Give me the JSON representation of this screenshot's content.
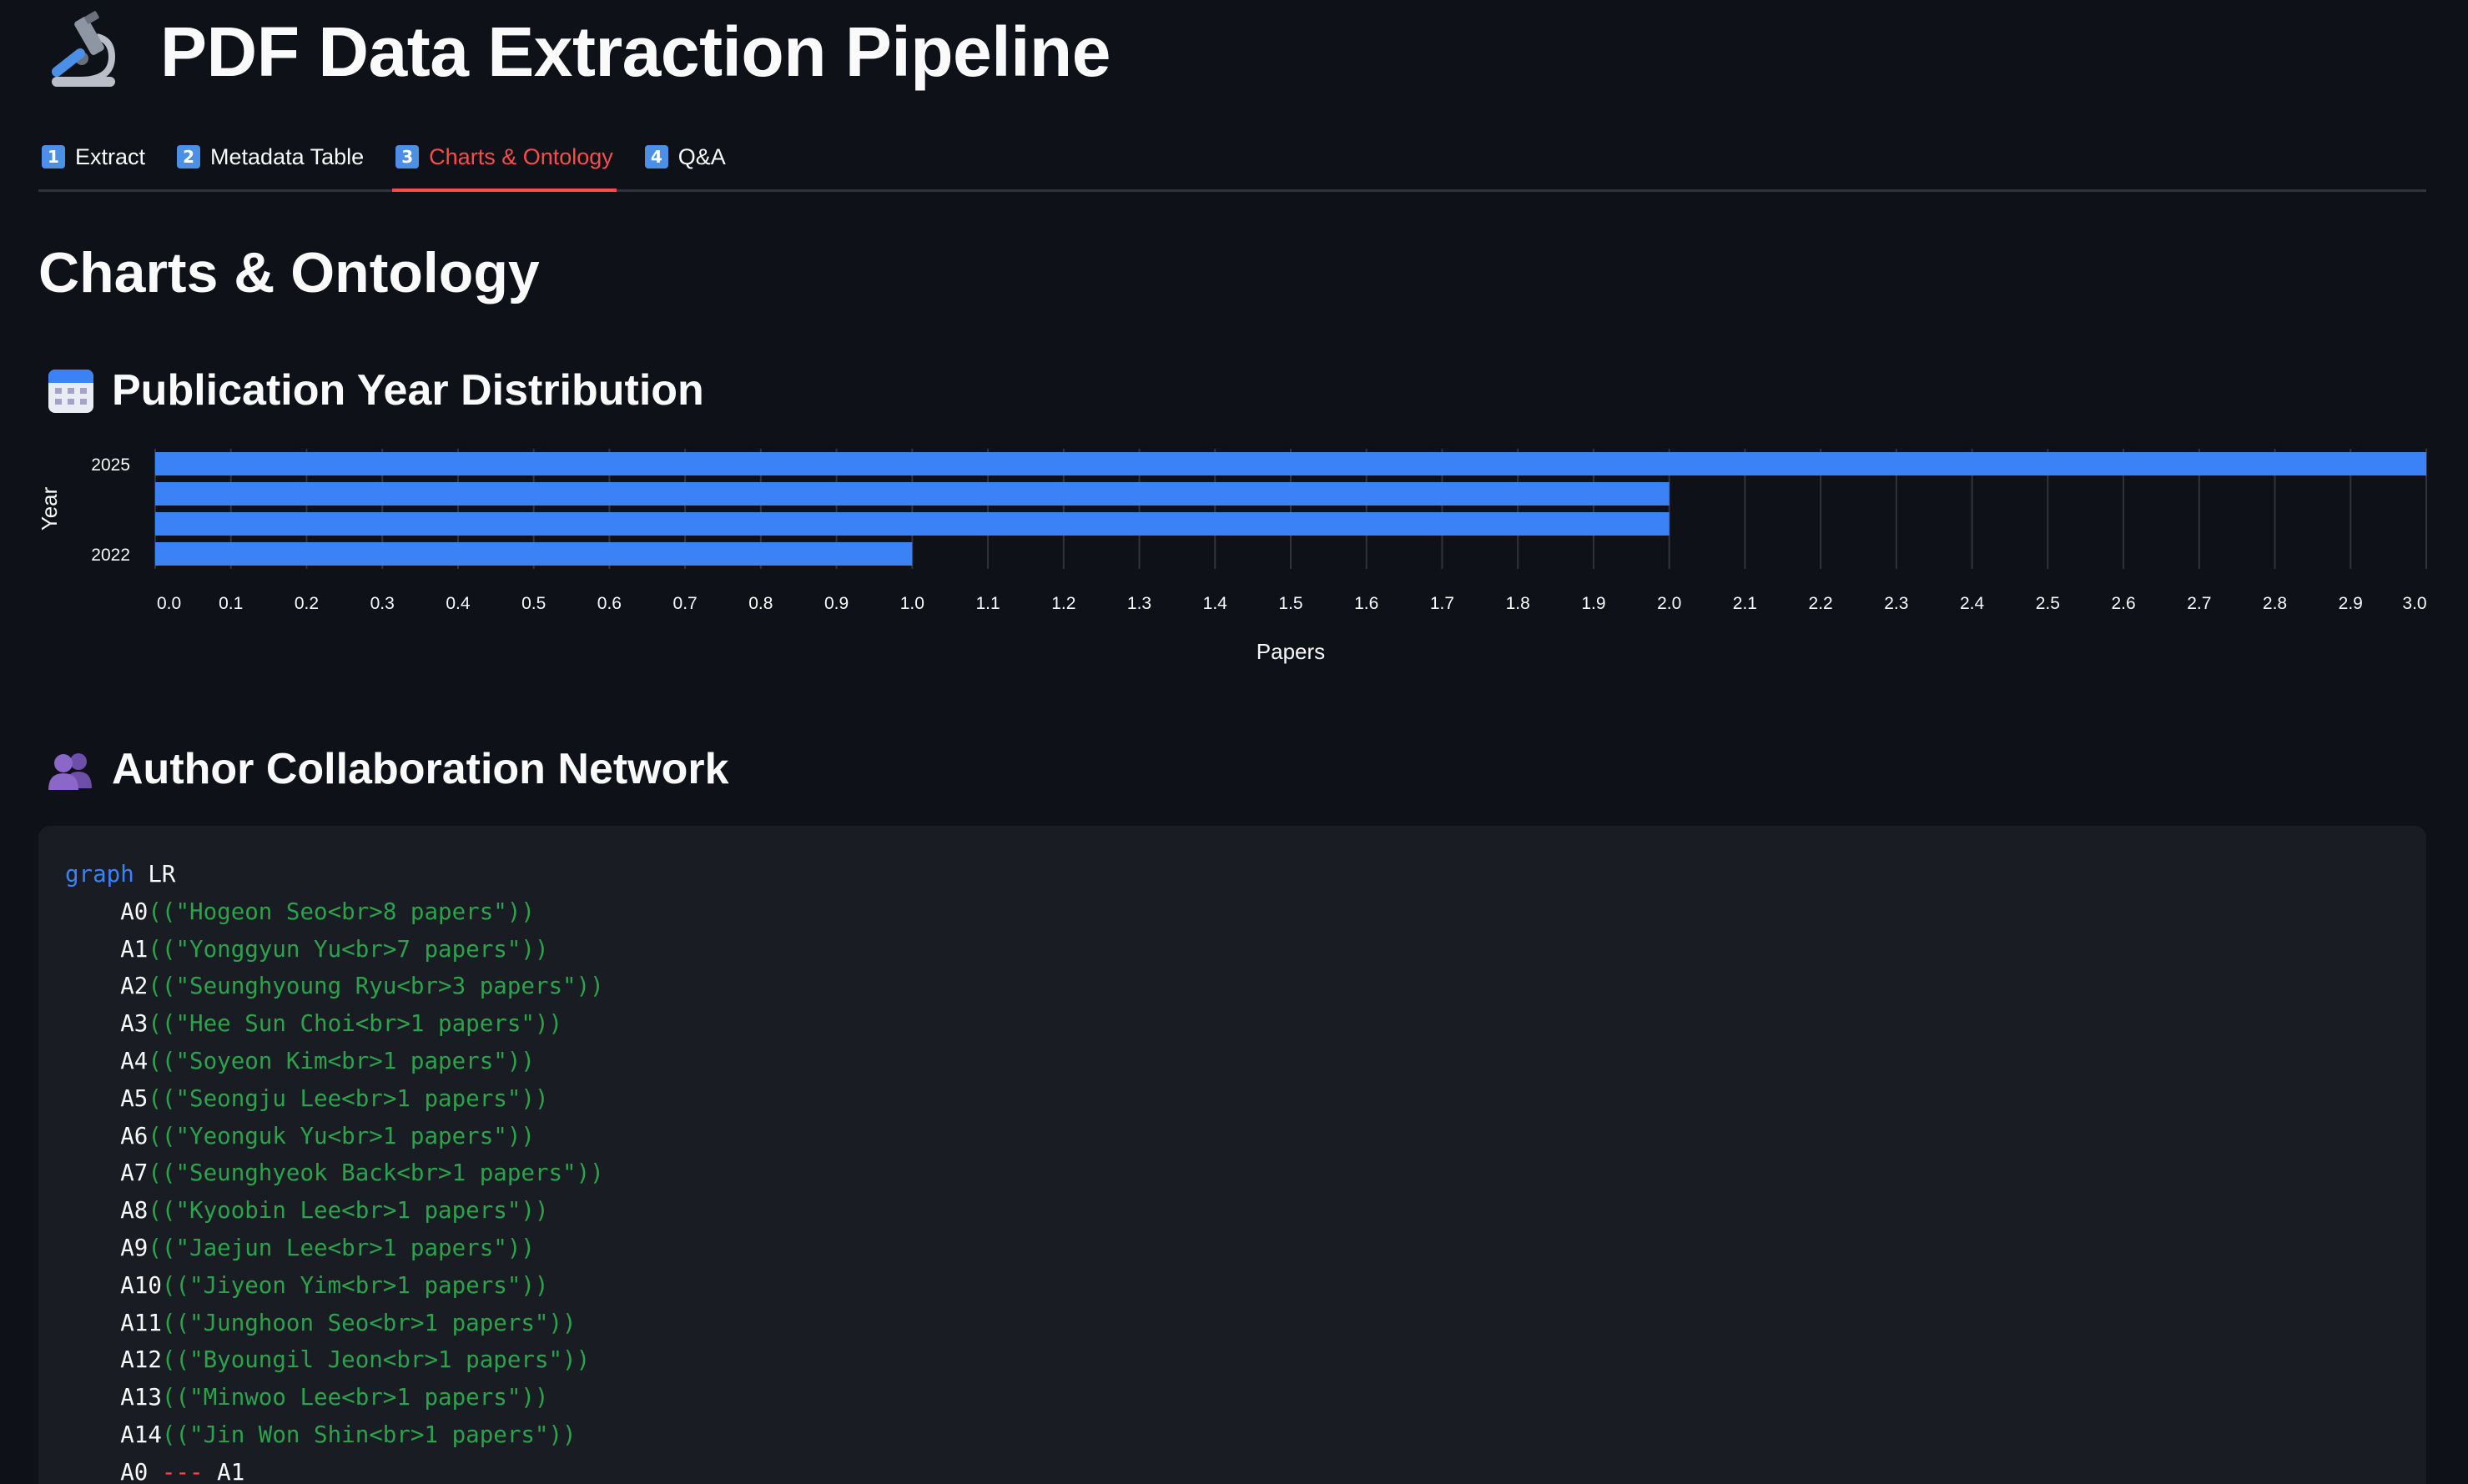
{
  "app": {
    "title": "PDF Data Extraction Pipeline",
    "icon": "microscope-icon"
  },
  "tabs": [
    {
      "num": "1",
      "label": "Extract",
      "active": false
    },
    {
      "num": "2",
      "label": "Metadata Table",
      "active": false
    },
    {
      "num": "3",
      "label": "Charts & Ontology",
      "active": true
    },
    {
      "num": "4",
      "label": "Q&A",
      "active": false
    }
  ],
  "main": {
    "section_title": "Charts & Ontology",
    "year_header": "Publication Year Distribution",
    "year_icon": "calendar-icon",
    "network_header": "Author Collaboration Network",
    "network_icon": "people-icon"
  },
  "colors": {
    "background": "#0e1117",
    "bar": "#3b82f6",
    "accent": "#ff4b4b",
    "code_bg": "#1a1c24",
    "code_string": "#2aa34a",
    "code_keyword": "#3b82f6"
  },
  "chart_data": {
    "type": "bar",
    "orientation": "horizontal",
    "categories": [
      "2025",
      "",
      "",
      "2022"
    ],
    "values": [
      3,
      2,
      2,
      1
    ],
    "xlabel": "Papers",
    "ylabel": "Year",
    "xlim": [
      0,
      3
    ],
    "xticks": [
      "0.0",
      "0.1",
      "0.2",
      "0.3",
      "0.4",
      "0.5",
      "0.6",
      "0.7",
      "0.8",
      "0.9",
      "1.0",
      "1.1",
      "1.2",
      "1.3",
      "1.4",
      "1.5",
      "1.6",
      "1.7",
      "1.8",
      "1.9",
      "2.0",
      "2.1",
      "2.2",
      "2.3",
      "2.4",
      "2.5",
      "2.6",
      "2.7",
      "2.8",
      "2.9",
      "3.0"
    ],
    "grid": true
  },
  "code": {
    "keyword": "graph",
    "direction": "LR",
    "nodes": [
      {
        "id": "A0",
        "label": "((\"Hogeon Seo<br>8 papers\"))"
      },
      {
        "id": "A1",
        "label": "((\"Yonggyun Yu<br>7 papers\"))"
      },
      {
        "id": "A2",
        "label": "((\"Seunghyoung Ryu<br>3 papers\"))"
      },
      {
        "id": "A3",
        "label": "((\"Hee Sun Choi<br>1 papers\"))"
      },
      {
        "id": "A4",
        "label": "((\"Soyeon Kim<br>1 papers\"))"
      },
      {
        "id": "A5",
        "label": "((\"Seongju Lee<br>1 papers\"))"
      },
      {
        "id": "A6",
        "label": "((\"Yeonguk Yu<br>1 papers\"))"
      },
      {
        "id": "A7",
        "label": "((\"Seunghyeok Back<br>1 papers\"))"
      },
      {
        "id": "A8",
        "label": "((\"Kyoobin Lee<br>1 papers\"))"
      },
      {
        "id": "A9",
        "label": "((\"Jaejun Lee<br>1 papers\"))"
      },
      {
        "id": "A10",
        "label": "((\"Jiyeon Yim<br>1 papers\"))"
      },
      {
        "id": "A11",
        "label": "((\"Junghoon Seo<br>1 papers\"))"
      },
      {
        "id": "A12",
        "label": "((\"Byoungil Jeon<br>1 papers\"))"
      },
      {
        "id": "A13",
        "label": "((\"Minwoo Lee<br>1 papers\"))"
      },
      {
        "id": "A14",
        "label": "((\"Jin Won Shin<br>1 papers\"))"
      }
    ],
    "edges": [
      {
        "from": "A0",
        "op": "---",
        "to": "A1"
      }
    ]
  }
}
